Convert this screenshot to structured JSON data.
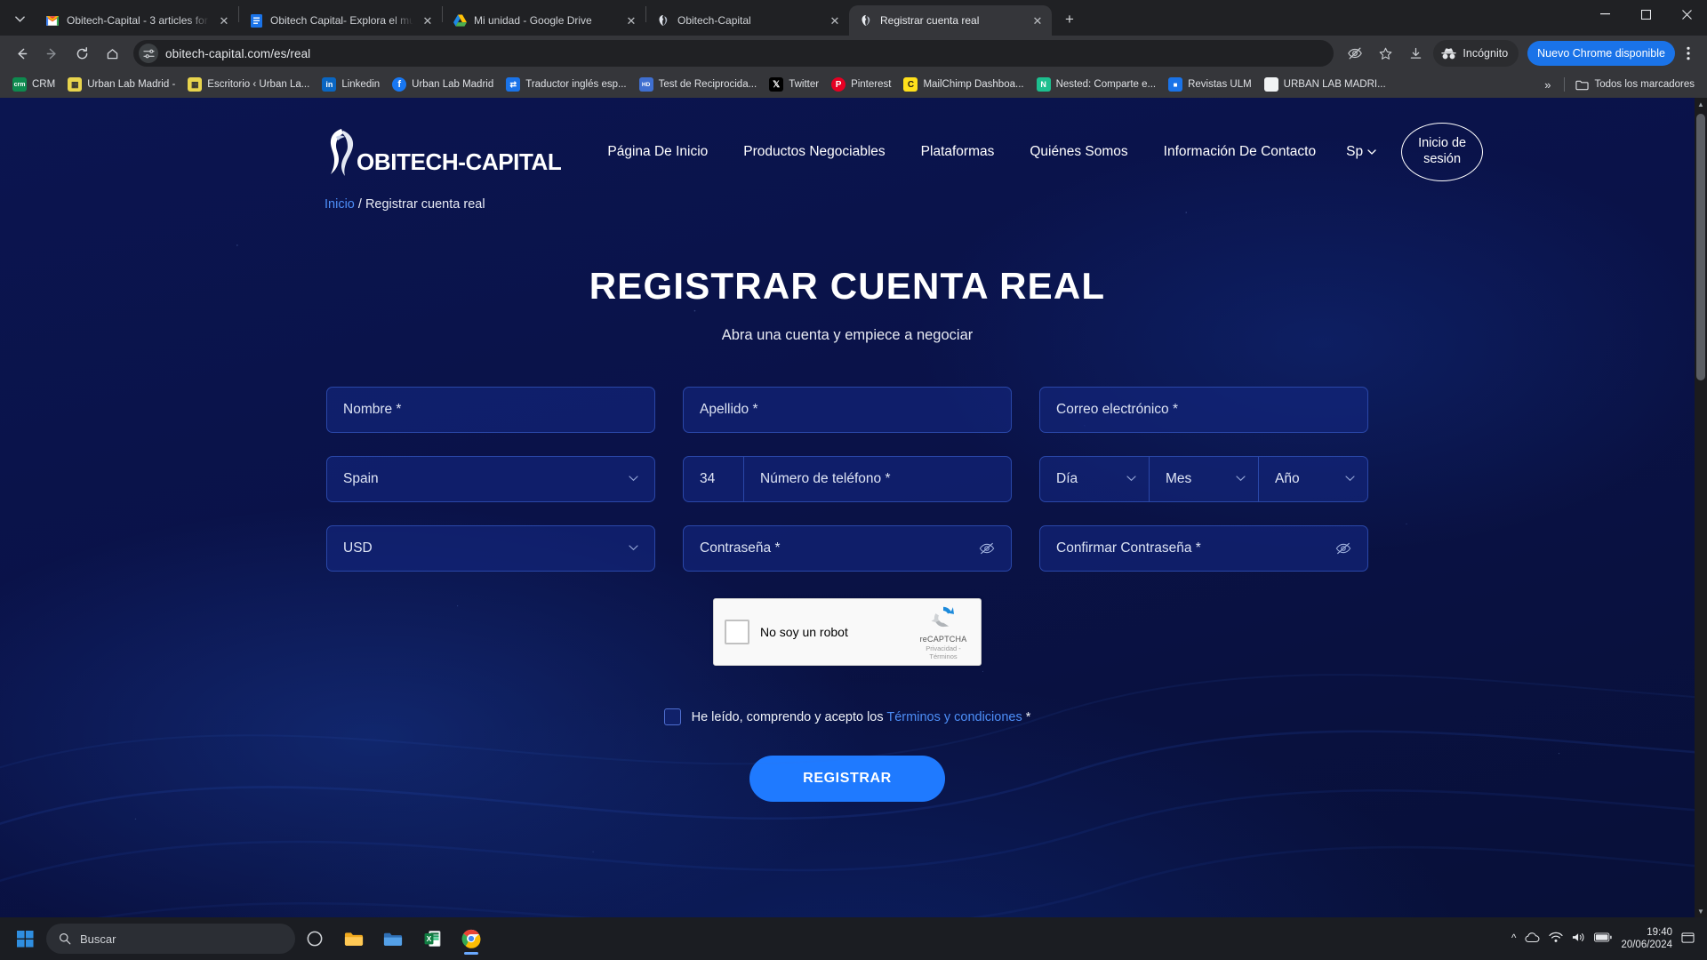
{
  "browser": {
    "tabs": [
      {
        "title": "Obitech-Capital - 3 articles for",
        "favicon": "gmail-icon",
        "active": false
      },
      {
        "title": "Obitech Capital- Explora el mu",
        "favicon": "docs-icon",
        "active": false
      },
      {
        "title": "Mi unidad - Google Drive",
        "favicon": "drive-icon",
        "active": false
      },
      {
        "title": "Obitech-Capital",
        "favicon": "obitech-icon",
        "active": false
      },
      {
        "title": "Registrar cuenta real",
        "favicon": "obitech-icon",
        "active": true
      }
    ],
    "new_tab_label": "+",
    "window_controls": {
      "minimize": "—",
      "maximize": "☐",
      "close": "✕"
    },
    "toolbar": {
      "back": "back-arrow",
      "forward": "forward-arrow",
      "reload": "reload-icon",
      "home": "home-icon",
      "url": "obitech-capital.com/es/real",
      "site_info_icon": "tune-icon",
      "incognito_label": "Incógnito",
      "update_label": "Nuevo Chrome disponible",
      "menu_icon": "kebab-menu-icon"
    },
    "bookmarks": [
      {
        "label": "CRM",
        "icon_color": "#0e8a4f",
        "letter": "crm"
      },
      {
        "label": "Urban Lab Madrid -",
        "icon_color": "#e8d44d",
        "letter": "▒"
      },
      {
        "label": "Escritorio ‹ Urban La...",
        "icon_color": "#e8d44d",
        "letter": "▒"
      },
      {
        "label": "Linkedin",
        "icon_color": "#0a66c2",
        "letter": "in"
      },
      {
        "label": "Urban Lab Madrid",
        "icon_color": "#1877f2",
        "letter": "f"
      },
      {
        "label": "Traductor inglés esp...",
        "icon_color": "#1a73e8",
        "letter": "⇄"
      },
      {
        "label": "Test de Reciprocida...",
        "icon_color": "#3f6fd0",
        "letter": "HD"
      },
      {
        "label": "Twitter",
        "icon_color": "#000000",
        "letter": "X"
      },
      {
        "label": "Pinterest",
        "icon_color": "#e60023",
        "letter": "P"
      },
      {
        "label": "MailChimp Dashboa...",
        "icon_color": "#ffe01b",
        "letter": "C"
      },
      {
        "label": "Nested: Comparte e...",
        "icon_color": "#1dbf8f",
        "letter": "N"
      },
      {
        "label": "Revistas ULM",
        "icon_color": "#1a73e8",
        "letter": "■"
      },
      {
        "label": "URBAN LAB MADRI...",
        "icon_color": "#f1f3f4",
        "letter": ""
      }
    ],
    "bookmarks_overflow": "»",
    "all_bookmarks_label": "Todos los marcadores"
  },
  "site": {
    "logo_text": "OBITECH-CAPITAL",
    "nav": [
      {
        "label": "Página De Inicio"
      },
      {
        "label": "Productos Negociables"
      },
      {
        "label": "Plataformas"
      },
      {
        "label": "Quiénes Somos"
      },
      {
        "label": "Información De Contacto"
      }
    ],
    "language": "Sp",
    "login_label": "Inicio de sesión",
    "breadcrumb": {
      "home": "Inicio",
      "separator": "/",
      "current": "Registrar cuenta real"
    }
  },
  "hero": {
    "title": "REGISTRAR CUENTA REAL",
    "subtitle": "Abra una cuenta y empiece a negociar"
  },
  "form": {
    "first_name_placeholder": "Nombre *",
    "last_name_placeholder": "Apellido *",
    "email_placeholder": "Correo electrónico *",
    "country_value": "Spain",
    "phone_code": "34",
    "phone_placeholder": "Número de teléfono *",
    "day_value": "Día",
    "month_value": "Mes",
    "year_value": "Año",
    "currency_value": "USD",
    "password_placeholder": "Contraseña *",
    "confirm_password_placeholder": "Confirmar Contraseña *",
    "chevron": "⌄"
  },
  "captcha": {
    "label": "No soy un robot",
    "brand": "reCAPTCHA",
    "terms": "Privacidad - Términos"
  },
  "terms": {
    "text_before": "He leído, comprendo y acepto los",
    "link": "Términos y condiciones",
    "required": "*"
  },
  "submit_label": "REGISTRAR",
  "taskbar": {
    "search_placeholder": "Buscar",
    "apps": [
      {
        "name": "copilot-icon"
      },
      {
        "name": "folder-icon"
      },
      {
        "name": "file-explorer-icon"
      },
      {
        "name": "excel-icon"
      },
      {
        "name": "chrome-icon"
      }
    ],
    "tray": {
      "chevron": "∧",
      "battery": "battery-icon",
      "network": "network-icon",
      "volume": "volume-icon"
    },
    "time": "19:40",
    "date": "20/06/2024",
    "notification_icon": "notification-icon"
  },
  "colors": {
    "page_bg": "#0a1250",
    "accent": "#1f7aff",
    "link": "#4d8ef7",
    "field_bg": "#142780",
    "field_border": "#2a47a8",
    "chrome_bg": "#35363a",
    "taskbar_bg": "#1b1d22"
  }
}
